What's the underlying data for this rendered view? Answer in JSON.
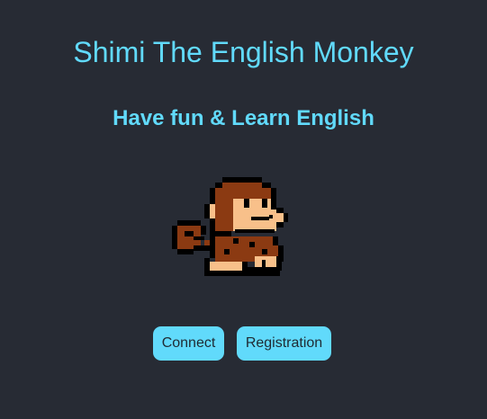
{
  "header": {
    "title": "Shimi The English Monkey",
    "subtitle": "Have fun & Learn English"
  },
  "mascot": {
    "icon": "monkey-icon",
    "colors": {
      "outline": "#000000",
      "fur": "#8b3a12",
      "skin": "#f8c08a"
    }
  },
  "actions": {
    "connect_label": "Connect",
    "registration_label": "Registration"
  },
  "theme": {
    "background": "#272b34",
    "accent": "#61dafb"
  }
}
